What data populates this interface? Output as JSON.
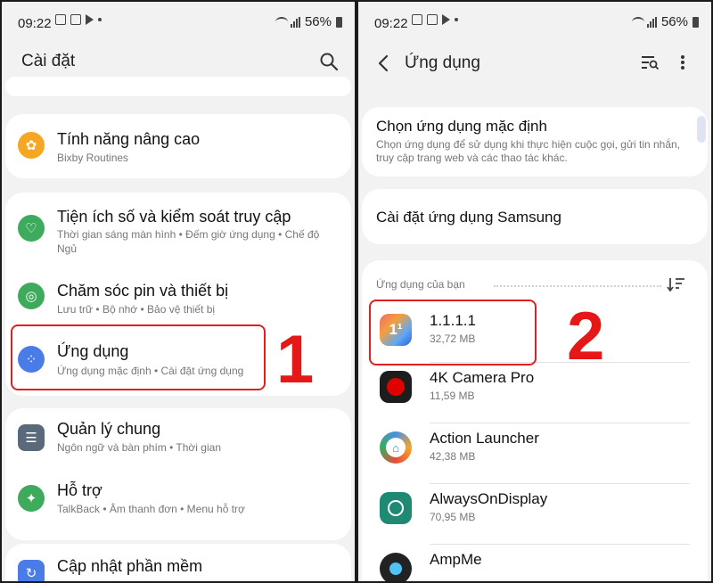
{
  "left": {
    "status": {
      "time": "09:22",
      "battery": "56%"
    },
    "title": "Cài đặt",
    "items": [
      {
        "title": "Tính năng nâng cao",
        "sub": "Bixby Routines"
      },
      {
        "title": "Tiện ích số và kiểm soát truy cập",
        "sub": "Thời gian sáng màn hình • Đếm giờ ứng dụng • Chế độ Ngủ"
      },
      {
        "title": "Chăm sóc pin và thiết bị",
        "sub": "Lưu trữ • Bộ nhớ • Bảo vệ thiết bị"
      },
      {
        "title": "Ứng dụng",
        "sub": "Ứng dụng mặc định • Cài đặt ứng dụng"
      },
      {
        "title": "Quản lý chung",
        "sub": "Ngôn ngữ và bàn phím • Thời gian"
      },
      {
        "title": "Hỗ trợ",
        "sub": "TalkBack • Âm thanh đơn • Menu hỗ trợ"
      },
      {
        "title": "Cập nhật phần mềm",
        "sub": ""
      }
    ],
    "annotation": "1"
  },
  "right": {
    "status": {
      "time": "09:22",
      "battery": "56%"
    },
    "title": "Ứng dụng",
    "default_apps": {
      "title": "Chọn ứng dụng mặc định",
      "sub": "Chọn ứng dụng để sử dụng khi thực hiện cuộc gọi, gửi tin nhắn, truy cập trang web và các thao tác khác."
    },
    "samsung_settings": "Cài đặt ứng dụng Samsung",
    "section_label": "Ứng dụng của bạn",
    "apps": [
      {
        "name": "1.1.1.1",
        "size": "32,72 MB"
      },
      {
        "name": "4K Camera Pro",
        "size": "11,59 MB"
      },
      {
        "name": "Action Launcher",
        "size": "42,38 MB"
      },
      {
        "name": "AlwaysOnDisplay",
        "size": "70,95 MB"
      },
      {
        "name": "AmpMe",
        "size": ""
      }
    ],
    "annotation": "2"
  },
  "colors": {
    "annotation_red": "#e51717",
    "accent_orange": "#f5a623",
    "accent_green": "#3daa5c",
    "accent_blue": "#4a7ce8"
  }
}
